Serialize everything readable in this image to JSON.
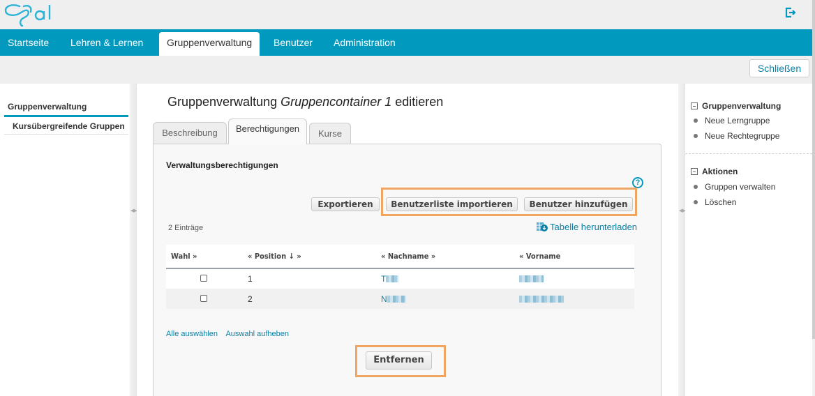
{
  "header": {
    "logo_text": "Opal",
    "logout_icon": "logout-icon"
  },
  "nav": {
    "items": [
      {
        "label": "Startseite",
        "active": false
      },
      {
        "label": "Lehren & Lernen",
        "active": false
      },
      {
        "label": "Gruppenverwaltung",
        "active": true
      },
      {
        "label": "Benutzer",
        "active": false
      },
      {
        "label": "Administration",
        "active": false
      }
    ]
  },
  "toolbar": {
    "close_label": "Schließen"
  },
  "left_nav": {
    "items": [
      {
        "label": "Gruppenverwaltung",
        "active": true
      },
      {
        "label": "Kursübergreifende Gruppen",
        "active": false
      }
    ]
  },
  "main": {
    "title_prefix": "Gruppenverwaltung ",
    "title_name": "Gruppencontainer 1",
    "title_suffix": " editieren",
    "tabs": [
      {
        "label": "Beschreibung",
        "active": false
      },
      {
        "label": "Berechtigungen",
        "active": true
      },
      {
        "label": "Kurse",
        "active": false
      }
    ],
    "section_title": "Verwaltungsberechtigungen",
    "help_icon": "?",
    "buttons": {
      "export": "Exportieren",
      "import": "Benutzerliste importieren",
      "add_user": "Benutzer hinzufügen",
      "remove": "Entfernen"
    },
    "entries_count": "2 Einträge",
    "download_label": "Tabelle herunterladen",
    "table": {
      "columns": [
        "Wahl »",
        "«  Position ↓ »",
        "«  Nachname »",
        "«  Vorname"
      ],
      "rows": [
        {
          "checked": false,
          "position": "1",
          "lastname": "T",
          "firstname": ""
        },
        {
          "checked": false,
          "position": "2",
          "lastname": "N",
          "firstname": ""
        }
      ]
    },
    "select_all": "Alle auswählen",
    "deselect_all": "Auswahl aufheben"
  },
  "right_panel": {
    "sections": [
      {
        "title": "Gruppenverwaltung",
        "items": [
          "Neue Lerngruppe",
          "Neue Rechtegruppe"
        ]
      },
      {
        "title": "Aktionen",
        "items": [
          "Gruppen verwalten",
          "Löschen"
        ]
      }
    ]
  },
  "colors": {
    "brand": "#0199bd",
    "link": "#0b7fa3",
    "highlight": "#f0a660"
  }
}
